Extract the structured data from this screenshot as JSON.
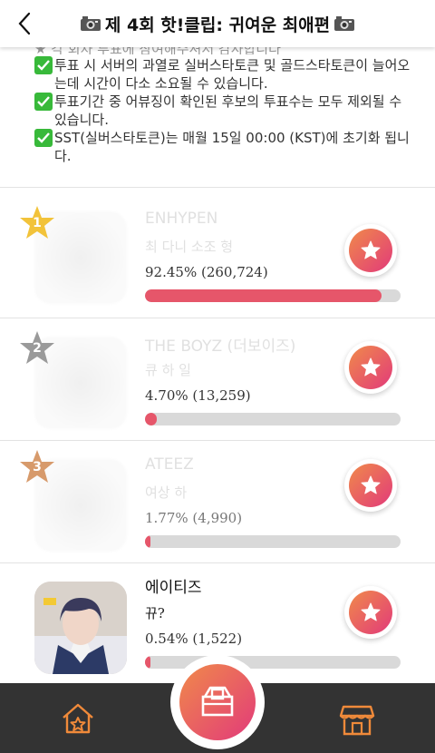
{
  "header": {
    "title": "제 4회 핫!클립: 귀여운 최애편"
  },
  "notices": {
    "cut_line": "★ 각 회차 투표에 참여해주셔서 감사합니다",
    "items": [
      "투표 시 서버의 과열로 실버스타토큰 및 골드스타토큰이 늘어오는데 시간이 다소 소요될 수 있습니다.",
      "투표기간 중 어뷰징이 확인된 후보의 투표수는 모두 제외될 수 있습니다.",
      "SST(실버스타토큰)는 매월 15일 00:00 (KST)에 초기화 됩니다."
    ]
  },
  "candidates": [
    {
      "rank": "1",
      "name": "ENHYPEN",
      "sub": "최 다니 소조 형",
      "percent_text": "92.45% (260,724)",
      "share": 0.9245,
      "faded": true
    },
    {
      "rank": "2",
      "name": "THE BOYZ (더보이즈)",
      "sub": "큐 하 일",
      "percent_text": "4.70% (13,259)",
      "share": 0.047,
      "faded": true
    },
    {
      "rank": "3",
      "name": "ATEEZ",
      "sub": "여상 하",
      "percent_text": "1.77% (4,990)",
      "share": 0.0177,
      "faded": true
    },
    {
      "rank": "",
      "name": "에이티즈",
      "sub": "뀨?",
      "percent_text": "0.54% (1,522)",
      "share": 0.0054,
      "faded": false
    }
  ],
  "colors": {
    "accent_start": "#f08a4a",
    "accent_end": "#e23a7a",
    "bar_fill": "#e6566a",
    "nav_bg": "#333333",
    "nav_icon": "#f08a3a"
  },
  "icons": {
    "back": "chevron-left-icon",
    "camera": "camera-icon",
    "check": "check-icon",
    "vote": "star-icon",
    "home": "home-star-icon",
    "vote_box": "ballot-box-icon",
    "store": "store-icon"
  }
}
